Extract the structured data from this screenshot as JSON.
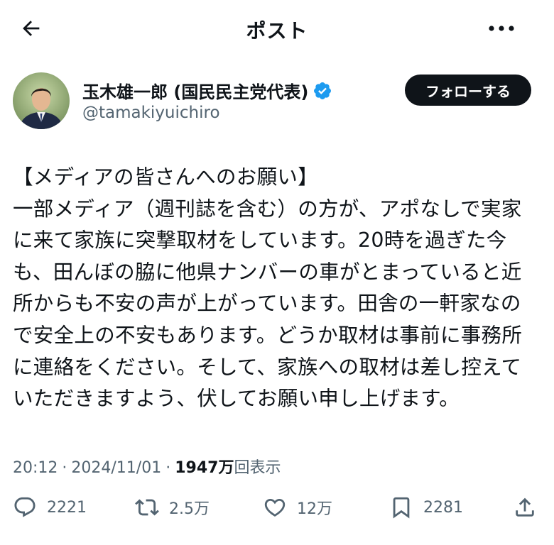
{
  "header": {
    "title": "ポスト",
    "back_icon": "arrow-left-icon",
    "more_icon": "more-horizontal-icon"
  },
  "author": {
    "display_name": "玉木雄一郎 (国民民主党代表)",
    "handle": "@tamakiyuichiro",
    "verified_icon": "verified-badge-icon",
    "verified_color": "#1d9bf0",
    "follow_label": "フォローする"
  },
  "post": {
    "lines": [
      "【メディアの皆さんへのお願い】",
      "一部メディア（週刊誌を含む）の方が、アポなしで実家",
      "に来て家族に突撃取材をしています。20時を過ぎた今",
      "も、田んぼの脇に他県ナンバーの車がとまっていると近",
      "所からも不安の声が上がっています。田舎の一軒家なの",
      "で安全上の不安もあります。どうか取材は事前に事務所",
      "に連絡をください。そして、家族への取材は差し控えて",
      "いただきますよう、伏してお願い申し上げます。"
    ]
  },
  "meta": {
    "time": "20:12",
    "separator": "·",
    "date": "2024/11/01",
    "views_count": "1947万",
    "views_label": "回表示"
  },
  "actions": {
    "reply": {
      "icon": "reply-icon",
      "count": "2221"
    },
    "repost": {
      "icon": "repost-icon",
      "count": "2.5万"
    },
    "like": {
      "icon": "heart-icon",
      "count": "12万"
    },
    "bookmark": {
      "icon": "bookmark-icon",
      "count": "2281"
    },
    "share": {
      "icon": "share-icon"
    }
  },
  "colors": {
    "text_primary": "#0f1419",
    "text_secondary": "#536471",
    "follow_button_bg": "#0f1419"
  }
}
